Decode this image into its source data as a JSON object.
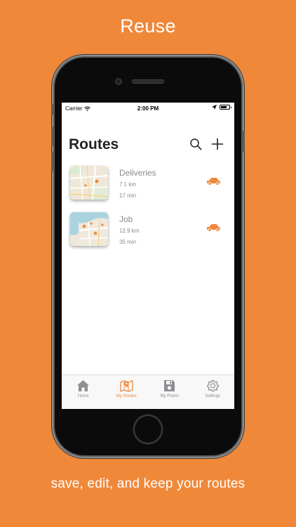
{
  "headline": "Reuse",
  "tagline": "save, edit, and keep your routes",
  "status_bar": {
    "carrier": "Carrier",
    "time": "2:00 PM"
  },
  "nav": {
    "title": "Routes"
  },
  "routes": [
    {
      "name": "Deliveries",
      "distance": "7.1 km",
      "duration": "17 min"
    },
    {
      "name": "Job",
      "distance": "12.9 km",
      "duration": "35 min"
    }
  ],
  "tabs": [
    {
      "label": "Home",
      "icon": "house-icon"
    },
    {
      "label": "My Routes",
      "icon": "map-pin-icon"
    },
    {
      "label": "My Points",
      "icon": "floppy-disk-icon"
    },
    {
      "label": "Settings",
      "icon": "gear-icon"
    }
  ],
  "colors": {
    "accent": "#F0883A",
    "inactive_tab": "#8e8e93"
  }
}
